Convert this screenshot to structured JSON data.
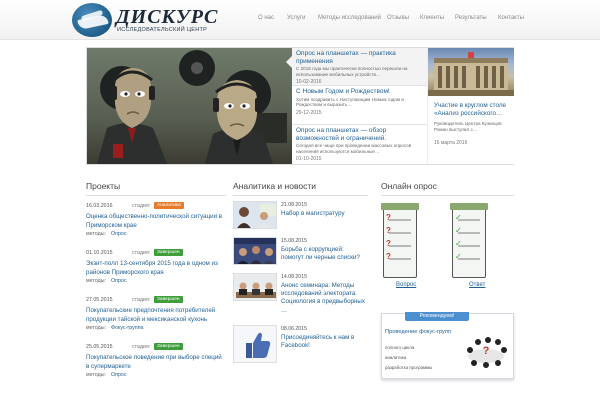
{
  "brand": {
    "name": "ДИСКУРС",
    "subtitle": "ИССЛЕДОВАТЕЛЬСКИЙ ЦЕНТР"
  },
  "nav": {
    "items": [
      "О нас",
      "Услуги",
      "Методы исследований",
      "Отзывы",
      "Клиенты",
      "Результаты",
      "Контакты"
    ]
  },
  "hero": {
    "items": [
      {
        "title": "Опрос на планшетах — практика применения",
        "desc": "С 2015 года мы практически полностью перешли на использование мобильных устройств…",
        "date": "10-02-2016"
      },
      {
        "title": "С Новым Годом и Рождеством!",
        "desc": "Хотим поздравить с Наступающим Новым годом и Рождеством и выразить…",
        "date": "29-12-2015"
      },
      {
        "title": "Опрос на планшетах — обзор возможностей и ограничений.",
        "desc": "Сегодня все чаще при проведении массовых опросов населения используются мобильные…",
        "date": "01-10-2015"
      }
    ],
    "side": {
      "title": "Участие в круглом столе «Анализ российского…",
      "desc": "Руководитель Центра Кузнецов Роман выступил с…",
      "date": "16 марта 2016"
    }
  },
  "sections": {
    "projects": "Проекты",
    "news": "Аналитика и новости",
    "poll": "Онлайн опрос"
  },
  "projects": {
    "stage_label": "стадия:",
    "methods_label": "методы:",
    "items": [
      {
        "date": "16.03.2016",
        "stage": "Аналитика",
        "title": "Оценка общественно-политической ситуации в Приморском крае",
        "method": "Опрос"
      },
      {
        "date": "01.10.2015",
        "stage": "Завершен",
        "title": "Экзит-полл 13-сентября 2015 года в одном из районов Приморского края",
        "method": "Опрос"
      },
      {
        "date": "27.05.2015",
        "stage": "Завершен",
        "title": "Покупательские предпочтения потребителей продукции тайской и мексиканской кухонь",
        "method": "Фокус-группа"
      },
      {
        "date": "25.05.2015",
        "stage": "Завершен",
        "title": "Покупательское поведение при выборе специй в супермаркете",
        "method": "Опрос"
      }
    ]
  },
  "news": {
    "items": [
      {
        "date": "21.08.2015",
        "title": "Набор в магистратуру"
      },
      {
        "date": "15.08.2015",
        "title": "Борьба с коррупцией: помогут ли черные списки?"
      },
      {
        "date": "14.08.2015",
        "title": "Анонс семинара: Методы исследований электората. Социология в предвыборных …"
      },
      {
        "date": "08.06.2015",
        "title": "Присоединяйтесь к нам в Facebook!"
      }
    ]
  },
  "poll": {
    "question_link": "Вопрос",
    "answer_link": "Ответ"
  },
  "recommend": {
    "tab": "Рекомендуем!",
    "title": "Проведение фокус-групп",
    "items": [
      "полного цикла",
      "аналитика",
      "разработка программы"
    ]
  },
  "colors": {
    "accent": "#1e5f96",
    "stage_analytics": "#e87a2c",
    "stage_done": "#3e9e3a",
    "rec_tab": "#4b8fd0"
  }
}
